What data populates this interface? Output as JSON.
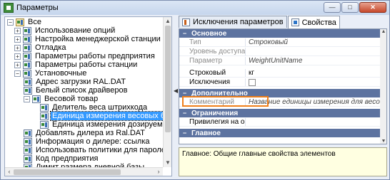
{
  "window": {
    "title": "Параметры",
    "buttons": {
      "minimize": "—",
      "maximize": "□",
      "close": "✕"
    }
  },
  "tree": {
    "items": [
      {
        "label": "Все",
        "expander": "−"
      },
      {
        "label": "Использование опций",
        "expander": "+"
      },
      {
        "label": "Настройка менеджерской станции",
        "expander": "+"
      },
      {
        "label": "Отладка",
        "expander": "+"
      },
      {
        "label": "Параметры работы предприятия",
        "expander": "+"
      },
      {
        "label": "Параметры работы станции",
        "expander": "+"
      },
      {
        "label": "Установочные",
        "expander": "−"
      },
      {
        "label": "Адрес загрузки RAL.DAT",
        "expander": ""
      },
      {
        "label": "Белый список драйверов",
        "expander": ""
      },
      {
        "label": "Весовой товар",
        "expander": "−"
      },
      {
        "label": "Делитель веса штрихкода",
        "expander": ""
      },
      {
        "label": "Единица измерения весовых блюд",
        "expander": "",
        "selected": true
      },
      {
        "label": "Единица измерения дозируемых блюд",
        "expander": ""
      },
      {
        "label": "Добавлять дилера из Ral.DAT",
        "expander": ""
      },
      {
        "label": "Информация о дилере: ссылка",
        "expander": ""
      },
      {
        "label": "Использовать политики для паролей",
        "expander": ""
      },
      {
        "label": "Код предприятия",
        "expander": ""
      },
      {
        "label": "Лимит размера дневной базы",
        "expander": ""
      }
    ]
  },
  "tabs": [
    {
      "label": "Исключения параметров",
      "icon": "exclusions-icon",
      "active": false
    },
    {
      "label": "Свойства",
      "icon": "properties-icon",
      "active": true
    }
  ],
  "grid": {
    "categories": {
      "basic": "Основное",
      "additional": "Дополнительно",
      "restrictions": "Ограничения",
      "main": "Главное"
    },
    "rows": {
      "type": {
        "name": "Тип",
        "value": "Строковый"
      },
      "access": {
        "name": "Уровень доступа",
        "value": ""
      },
      "param": {
        "name": "Параметр",
        "value": "WeightUnitName"
      },
      "string": {
        "name": "Строковый",
        "value": "кг"
      },
      "exceptions": {
        "name": "Исключения",
        "value": ""
      },
      "comment": {
        "name": "Комментарий",
        "value": "Название единицы измерения для весовых блюд"
      },
      "binding": {
        "name": "Привилегия на объект",
        "value": ""
      }
    }
  },
  "description": "Главное: Общие главные свойства элементов",
  "colors": {
    "category": "#5d73a0",
    "highlight": "#ef7f1a",
    "selected": "#3399ff"
  }
}
